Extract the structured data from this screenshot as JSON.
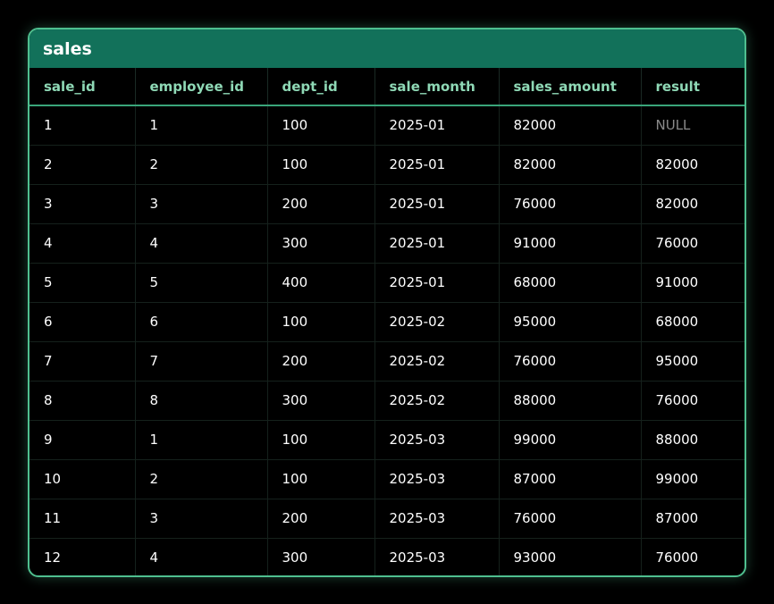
{
  "table": {
    "title": "sales",
    "columns": [
      "sale_id",
      "employee_id",
      "dept_id",
      "sale_month",
      "sales_amount",
      "result"
    ],
    "rows": [
      [
        "1",
        "1",
        "100",
        "2025-01",
        "82000",
        "NULL"
      ],
      [
        "2",
        "2",
        "100",
        "2025-01",
        "82000",
        "82000"
      ],
      [
        "3",
        "3",
        "200",
        "2025-01",
        "76000",
        "82000"
      ],
      [
        "4",
        "4",
        "300",
        "2025-01",
        "91000",
        "76000"
      ],
      [
        "5",
        "5",
        "400",
        "2025-01",
        "68000",
        "91000"
      ],
      [
        "6",
        "6",
        "100",
        "2025-02",
        "95000",
        "68000"
      ],
      [
        "7",
        "7",
        "200",
        "2025-02",
        "76000",
        "95000"
      ],
      [
        "8",
        "8",
        "300",
        "2025-02",
        "88000",
        "76000"
      ],
      [
        "9",
        "1",
        "100",
        "2025-03",
        "99000",
        "88000"
      ],
      [
        "10",
        "2",
        "100",
        "2025-03",
        "87000",
        "99000"
      ],
      [
        "11",
        "3",
        "200",
        "2025-03",
        "76000",
        "87000"
      ],
      [
        "12",
        "4",
        "300",
        "2025-03",
        "93000",
        "76000"
      ]
    ]
  },
  "colors": {
    "background": "#000000",
    "border": "#4fbf8f",
    "title_bar": "#12715a",
    "header_text": "#8fd9b6",
    "cell_text": "#ffffff",
    "null_text": "#8a8a8a"
  }
}
